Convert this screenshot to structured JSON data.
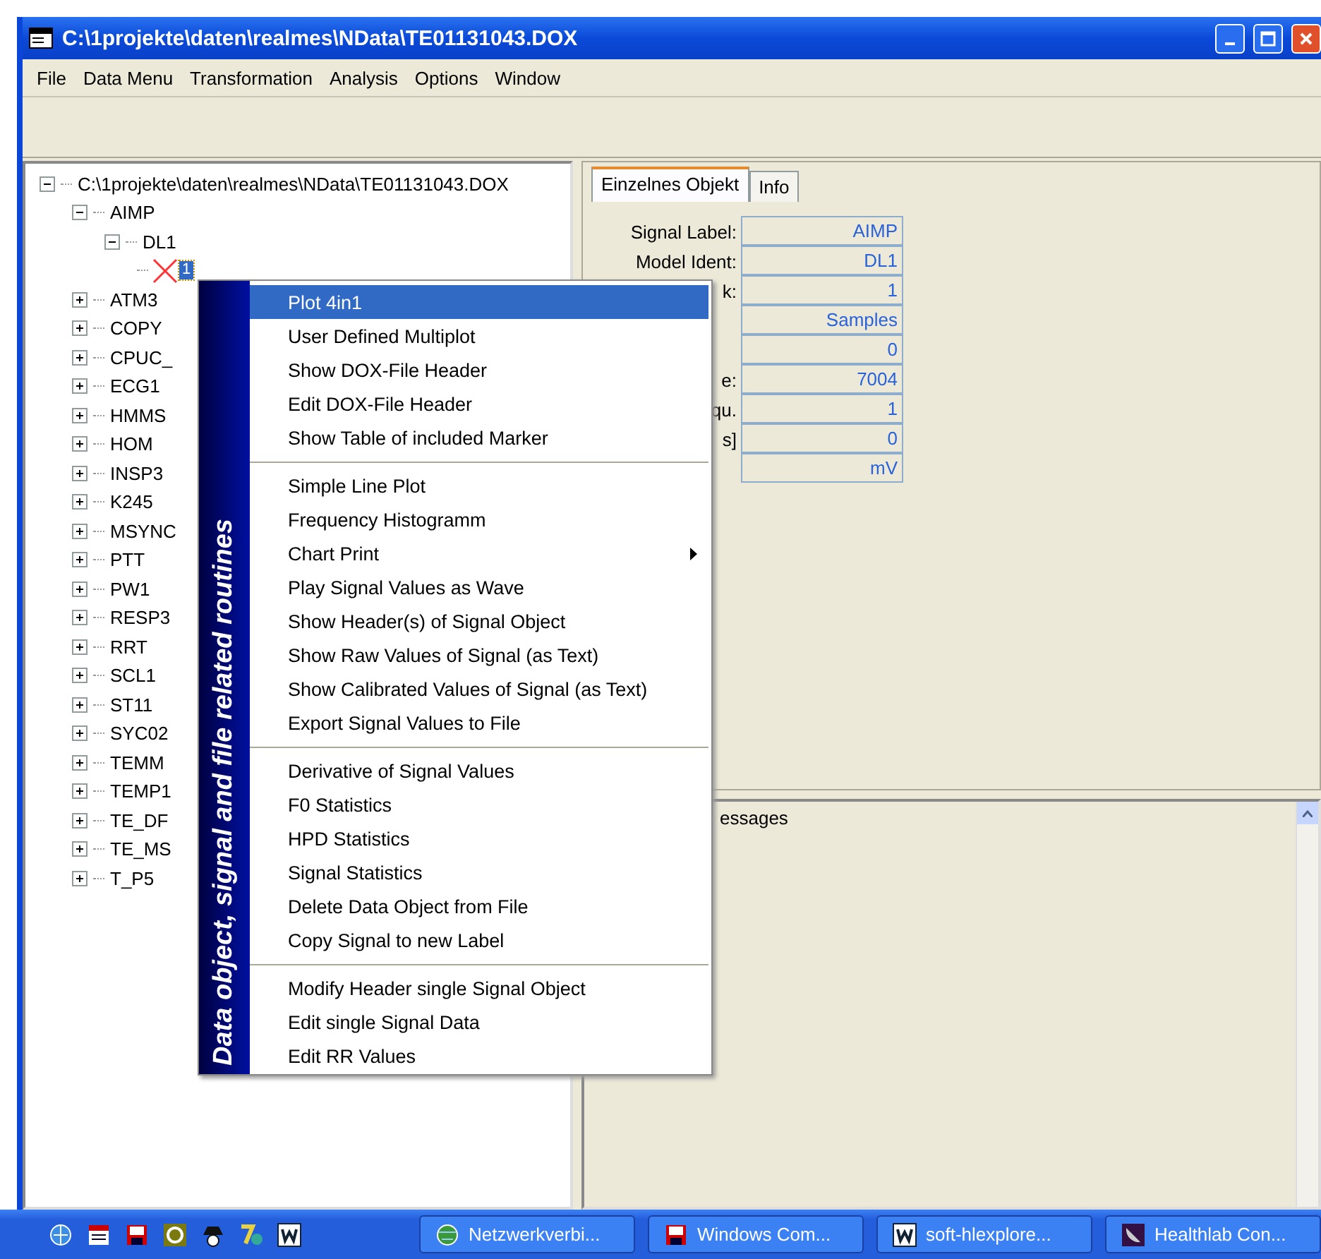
{
  "window": {
    "title": "C:\\1projekte\\daten\\realmes\\NData\\TE01131043.DOX"
  },
  "menu_bar": [
    "File",
    "Data Menu",
    "Transformation",
    "Analysis",
    "Options",
    "Window"
  ],
  "tree": {
    "label": "C:\\1projekte\\daten\\realmes\\NData\\TE01131043.DOX",
    "expanded": true,
    "selected": false,
    "children": [
      {
        "label": "AIMP",
        "expanded": true,
        "selected": false,
        "children": [
          {
            "label": "DL1",
            "expanded": true,
            "selected": false,
            "children": [
              {
                "label": "1",
                "selected": true
              }
            ]
          }
        ]
      },
      {
        "label": "ATM3",
        "expanded": false,
        "selected": false
      },
      {
        "label": "COPY",
        "expanded": false,
        "selected": false
      },
      {
        "label": "CPUC_",
        "expanded": false,
        "selected": false
      },
      {
        "label": "ECG1",
        "expanded": false,
        "selected": false
      },
      {
        "label": "HMMS",
        "expanded": false,
        "selected": false
      },
      {
        "label": "HOM",
        "expanded": false,
        "selected": false
      },
      {
        "label": "INSP3",
        "expanded": false,
        "selected": false
      },
      {
        "label": "K245",
        "expanded": false,
        "selected": false
      },
      {
        "label": "MSYNC",
        "expanded": false,
        "selected": false
      },
      {
        "label": "PTT",
        "expanded": false,
        "selected": false
      },
      {
        "label": "PW1",
        "expanded": false,
        "selected": false
      },
      {
        "label": "RESP3",
        "expanded": false,
        "selected": false
      },
      {
        "label": "RRT",
        "expanded": false,
        "selected": false
      },
      {
        "label": "SCL1",
        "expanded": false,
        "selected": false
      },
      {
        "label": "ST11",
        "expanded": false,
        "selected": false
      },
      {
        "label": "SYC02",
        "expanded": false,
        "selected": false
      },
      {
        "label": "TEMM",
        "expanded": false,
        "selected": false
      },
      {
        "label": "TEMP1",
        "expanded": false,
        "selected": false
      },
      {
        "label": "TE_DF",
        "expanded": false,
        "selected": false
      },
      {
        "label": "TE_MS",
        "expanded": false,
        "selected": false
      },
      {
        "label": "T_P5",
        "expanded": false,
        "selected": false
      }
    ]
  },
  "tabs": [
    {
      "label": "Einzelnes Objekt",
      "selected": true
    },
    {
      "label": "Info",
      "selected": false
    }
  ],
  "fields": [
    {
      "label": "Signal Label:",
      "value": "AIMP"
    },
    {
      "label": "Model Ident:",
      "value": "DL1"
    },
    {
      "label": "k:",
      "value": "1"
    },
    {
      "value": "Samples"
    },
    {
      "value": "0"
    },
    {
      "label": "e:",
      "value": "7004"
    },
    {
      "label": "qu.",
      "value": "1"
    },
    {
      "label": "s]",
      "value": "0"
    },
    {
      "value": "mV"
    }
  ],
  "messages": {
    "title": "essages"
  },
  "context_menu": {
    "banner": "Data object, signal and file related routines",
    "groups": [
      [
        {
          "label": "Plot 4in1",
          "selected": true,
          "submenu": false
        },
        {
          "label": "User Defined Multiplot",
          "selected": false,
          "submenu": false
        },
        {
          "label": "Show DOX-File Header",
          "selected": false,
          "submenu": false
        },
        {
          "label": "Edit DOX-File Header",
          "selected": false,
          "submenu": false
        },
        {
          "label": "Show Table of included Marker",
          "selected": false,
          "submenu": false
        }
      ],
      [
        {
          "label": "Simple Line Plot",
          "selected": false,
          "submenu": false
        },
        {
          "label": "Frequency Histogramm",
          "selected": false,
          "submenu": false
        },
        {
          "label": "Chart Print",
          "selected": false,
          "submenu": true
        },
        {
          "label": "Play Signal Values as Wave",
          "selected": false,
          "submenu": false
        },
        {
          "label": "Show  Header(s) of Signal Object",
          "selected": false,
          "submenu": false
        },
        {
          "label": "Show Raw Values of Signal (as Text)",
          "selected": false,
          "submenu": false
        },
        {
          "label": "Show Calibrated Values of Signal (as Text)",
          "selected": false,
          "submenu": false
        },
        {
          "label": "Export Signal Values to File",
          "selected": false,
          "submenu": false
        }
      ],
      [
        {
          "label": "Derivative of Signal Values",
          "selected": false,
          "submenu": false
        },
        {
          "label": "F0 Statistics",
          "selected": false,
          "submenu": false
        },
        {
          "label": "HPD Statistics",
          "selected": false,
          "submenu": false
        },
        {
          "label": "Signal Statistics",
          "selected": false,
          "submenu": false
        },
        {
          "label": "Delete Data Object from File",
          "selected": false,
          "submenu": false
        },
        {
          "label": "Copy Signal to new Label",
          "selected": false,
          "submenu": false
        }
      ],
      [
        {
          "label": "Modify Header single Signal Object",
          "selected": false,
          "submenu": false
        },
        {
          "label": "Edit single Signal Data",
          "selected": false,
          "submenu": false
        },
        {
          "label": "Edit RR Values",
          "selected": false,
          "submenu": false
        }
      ]
    ]
  },
  "taskbar": {
    "buttons": [
      {
        "label": "Netzwerkverbi..."
      },
      {
        "label": "Windows Com..."
      },
      {
        "label": "soft-hlexplore..."
      },
      {
        "label": "Healthlab Con..."
      }
    ]
  }
}
